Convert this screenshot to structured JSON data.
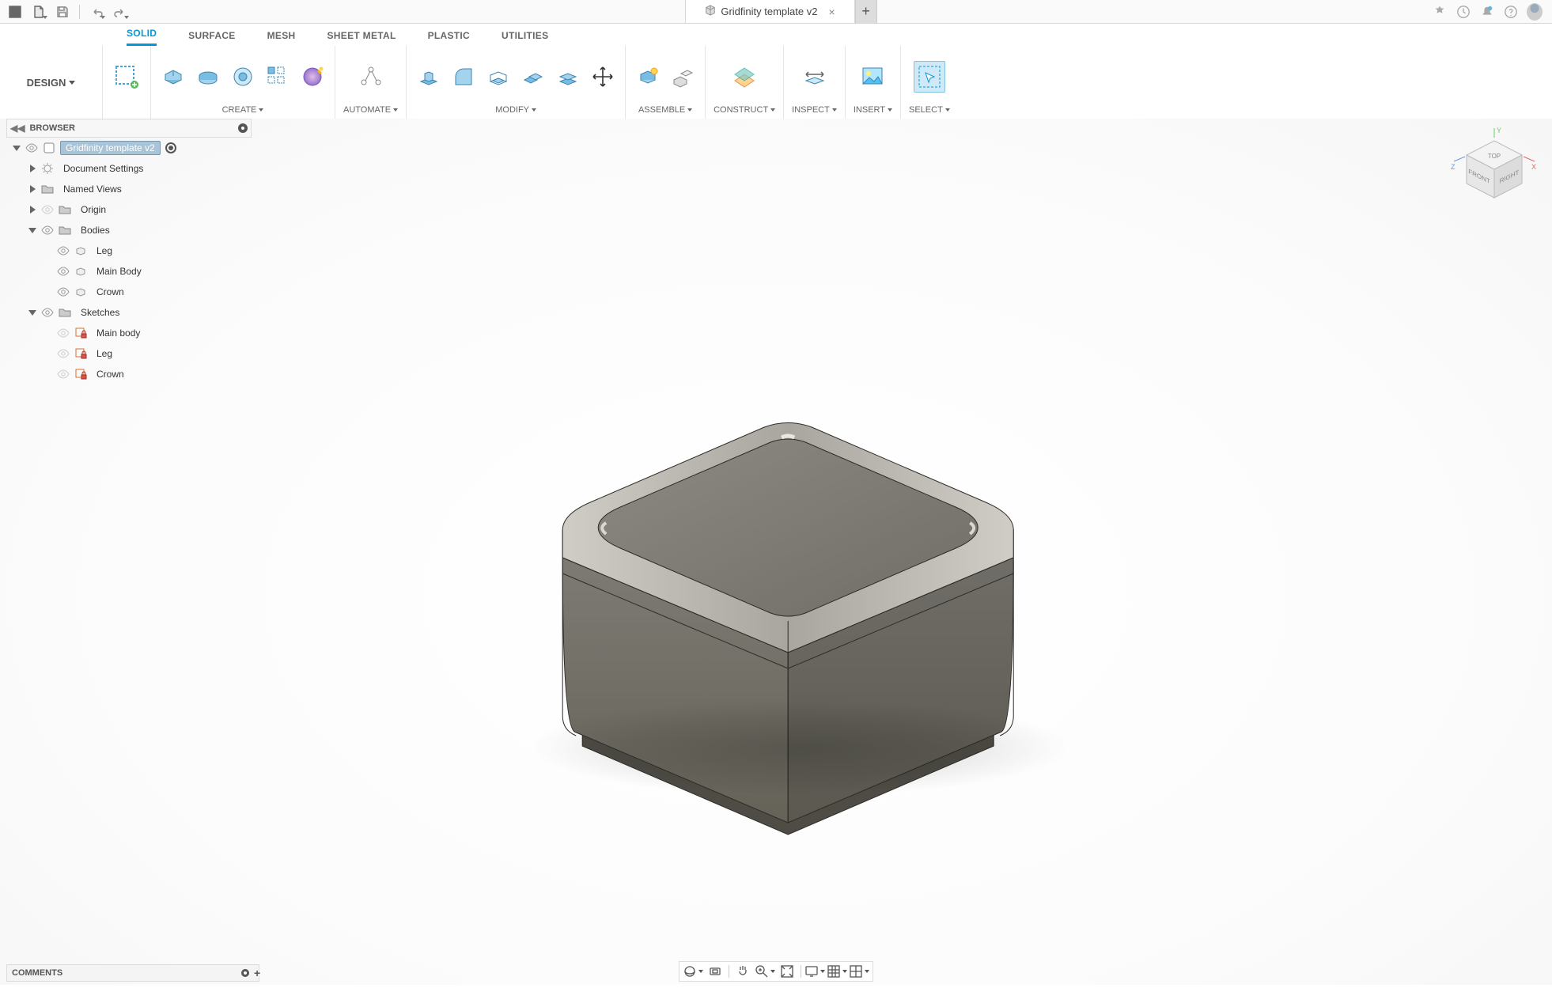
{
  "app": {
    "doc_title": "Gridfinity template v2"
  },
  "design_button": "DESIGN",
  "workspace_tabs": [
    "SOLID",
    "SURFACE",
    "MESH",
    "SHEET METAL",
    "PLASTIC",
    "UTILITIES"
  ],
  "workspace_active": "SOLID",
  "ribbon_groups": {
    "create": "CREATE",
    "automate": "AUTOMATE",
    "modify": "MODIFY",
    "assemble": "ASSEMBLE",
    "construct": "CONSTRUCT",
    "inspect": "INSPECT",
    "insert": "INSERT",
    "select": "SELECT"
  },
  "browser": {
    "title": "BROWSER",
    "root": "Gridfinity template v2",
    "items": [
      {
        "label": "Document Settings"
      },
      {
        "label": "Named Views"
      },
      {
        "label": "Origin"
      },
      {
        "label": "Bodies"
      },
      {
        "label": "Leg"
      },
      {
        "label": "Main Body"
      },
      {
        "label": "Crown"
      },
      {
        "label": "Sketches"
      },
      {
        "label": "Main body"
      },
      {
        "label": "Leg"
      },
      {
        "label": "Crown"
      }
    ]
  },
  "viewcube": {
    "top": "TOP",
    "front": "FRONT",
    "right": "RIGHT",
    "x": "X",
    "y": "Y",
    "z": "Z"
  },
  "comments": {
    "title": "COMMENTS"
  }
}
